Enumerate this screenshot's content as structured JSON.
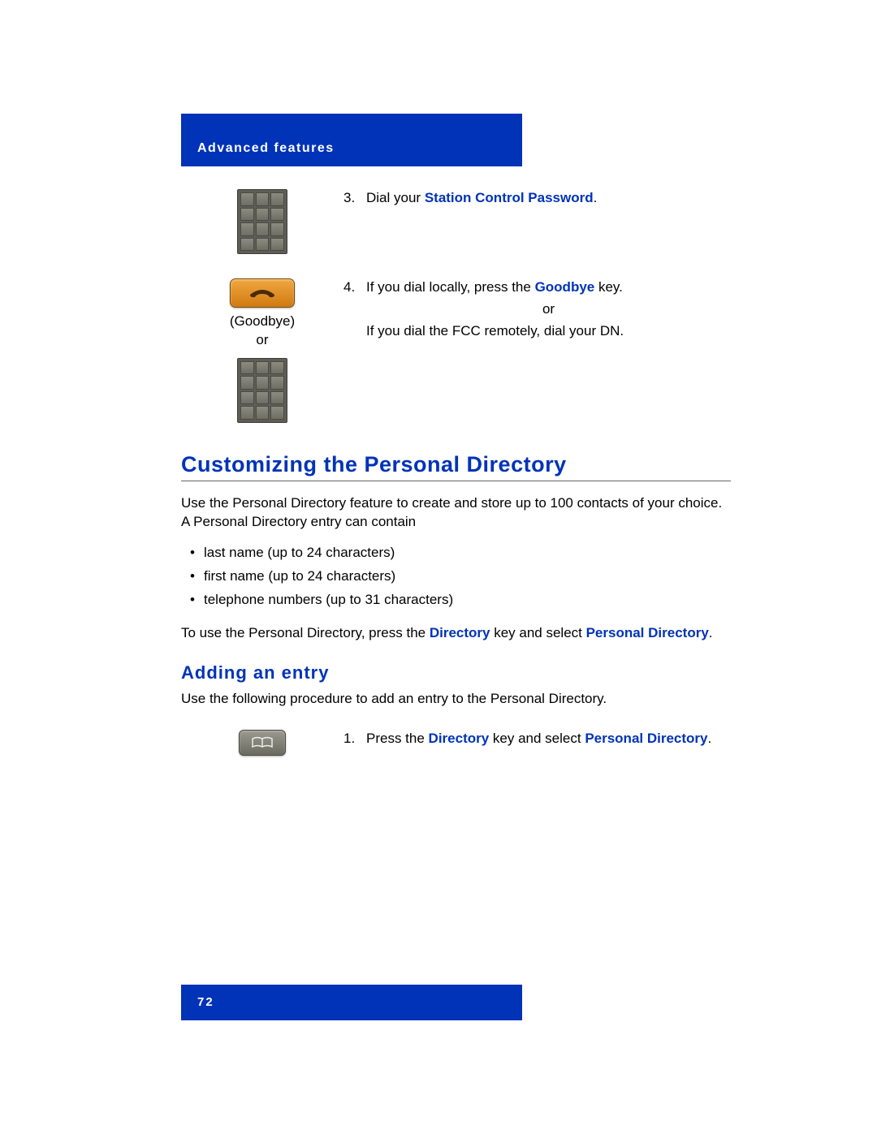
{
  "header": {
    "title": "Advanced features"
  },
  "step3": {
    "number": "3.",
    "pre": "Dial your ",
    "bold": "Station Control Password",
    "post": "."
  },
  "step4": {
    "number": "4.",
    "line1_pre": "If you dial locally, press the ",
    "line1_bold": "Goodbye",
    "line1_post": " key.",
    "or": "or",
    "line2": "If you dial the FCC remotely, dial your DN.",
    "caption_goodbye": "(Goodbye)",
    "caption_or": "or"
  },
  "section": {
    "title": "Customizing the Personal Directory",
    "intro": "Use the Personal Directory feature to create and store up to 100 contacts of your choice. A Personal Directory entry can contain",
    "bullets": [
      "last name (up to 24 characters)",
      "first name (up to 24 characters)",
      "telephone numbers (up to 31 characters)"
    ],
    "instruction_pre": "To use the Personal Directory, press the ",
    "instruction_bold1": "Directory",
    "instruction_mid": " key and select ",
    "instruction_bold2": "Personal Directory",
    "instruction_post": "."
  },
  "subsection": {
    "title": "Adding an entry",
    "intro": "Use the following procedure to add an entry to the Personal Directory."
  },
  "step1": {
    "number": "1.",
    "pre": "Press the ",
    "bold1": "Directory",
    "mid": " key and select ",
    "bold2": "Personal Directory",
    "post": "."
  },
  "footer": {
    "page_number": "72"
  }
}
